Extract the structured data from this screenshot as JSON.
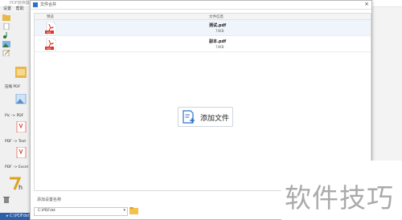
{
  "background_app": {
    "title": "PDF转换器",
    "menu": [
      "设置",
      "帮助"
    ],
    "status_text": "▸ C:\\PDFdst\\pdf...",
    "tools": [
      {
        "label": "压缩 PDF",
        "icon": "compress-icon"
      },
      {
        "label": "Pic -> PDF",
        "icon": "image-to-pdf-icon"
      },
      {
        "label": "PDF -> Text",
        "icon": "pdf-to-text-icon"
      },
      {
        "label": "PDF -> Excel",
        "icon": "pdf-to-excel-icon"
      }
    ]
  },
  "dialog": {
    "title": "文件合并",
    "columns": {
      "preview": "预览",
      "info": "文件信息"
    },
    "files": [
      {
        "name": "测试.pdf",
        "size": "74KB"
      },
      {
        "name": "副本.pdf",
        "size": "74KB"
      }
    ],
    "add_button_label": "添加文件",
    "output_label": "添加设置名称",
    "output_path": "C:\\PDFdst"
  },
  "watermark": "软件技巧",
  "colors": {
    "pdf_red": "#d9342b",
    "accent_blue": "#2e72c8",
    "folder_yellow": "#f2c14e"
  }
}
